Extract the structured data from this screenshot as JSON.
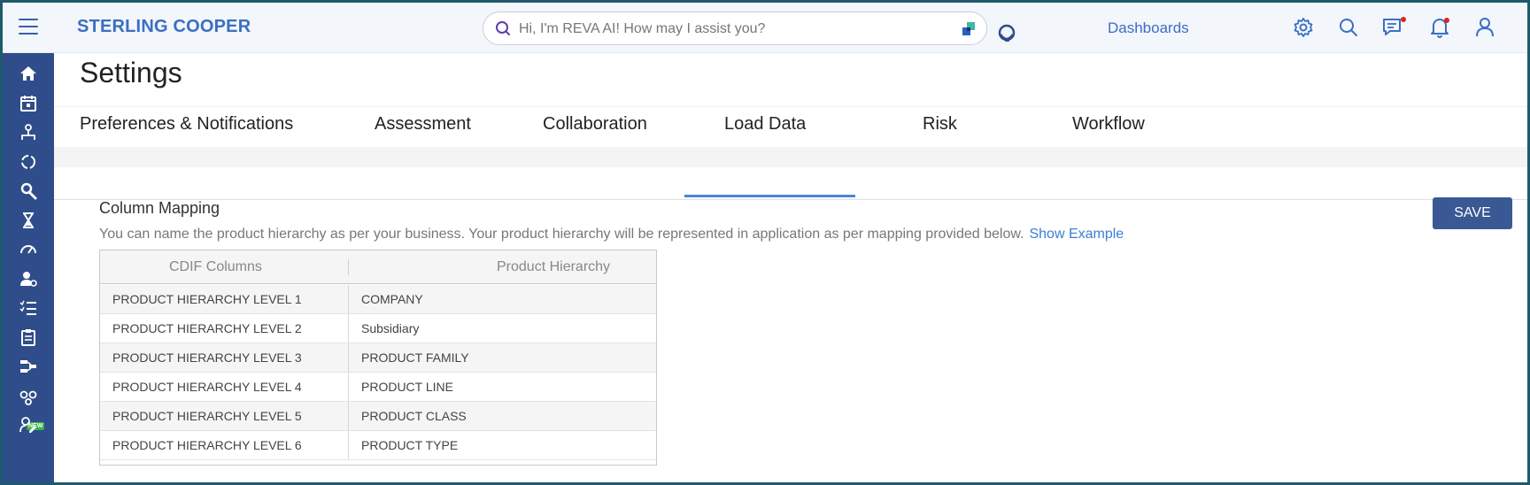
{
  "header": {
    "brand": "STERLING COOPER",
    "search_placeholder": "Hi, I'm REVA AI! How may I assist you?",
    "dashboards_label": "Dashboards",
    "icons": [
      "menu-icon",
      "search-icon",
      "agent-icon",
      "settings-icon",
      "search-icon",
      "messages-icon",
      "notifications-icon",
      "user-icon"
    ],
    "accent_color": "#3a6fc4",
    "alert_color": "#e02020"
  },
  "sidebar": {
    "items": [
      {
        "icon": "home-icon"
      },
      {
        "icon": "calendar-icon"
      },
      {
        "icon": "hierarchy-icon"
      },
      {
        "icon": "cycle-icon"
      },
      {
        "icon": "search-person-icon"
      },
      {
        "icon": "hourglass-icon"
      },
      {
        "icon": "gauge-icon"
      },
      {
        "icon": "user-settings-icon"
      },
      {
        "icon": "checklist-icon"
      },
      {
        "icon": "clipboard-icon"
      },
      {
        "icon": "workflow-icon"
      },
      {
        "icon": "new-feature-icon",
        "badge": "NEW"
      },
      {
        "icon": "user-edit-icon"
      }
    ],
    "background": "#2f4d8a"
  },
  "page": {
    "title": "Settings",
    "tabs": [
      {
        "label": "Preferences & Notifications",
        "active": false
      },
      {
        "label": "Assessment",
        "active": false
      },
      {
        "label": "Collaboration",
        "active": false
      },
      {
        "label": "Load Data",
        "active": true
      },
      {
        "label": "Risk",
        "active": false
      },
      {
        "label": "Workflow",
        "active": false
      }
    ]
  },
  "column_mapping": {
    "title": "Column Mapping",
    "description": "You can name the product hierarchy as per your business. Your product hierarchy will be represented in application as per mapping provided below.",
    "show_example": "Show Example",
    "save_label": "SAVE",
    "columns": [
      "CDIF Columns",
      "Product Hierarchy"
    ],
    "rows": [
      {
        "cdif": "PRODUCT HIERARCHY LEVEL 1",
        "hierarchy": "COMPANY"
      },
      {
        "cdif": "PRODUCT HIERARCHY LEVEL 2",
        "hierarchy": "Subsidiary"
      },
      {
        "cdif": "PRODUCT HIERARCHY LEVEL 3",
        "hierarchy": "PRODUCT FAMILY"
      },
      {
        "cdif": "PRODUCT HIERARCHY LEVEL 4",
        "hierarchy": "PRODUCT LINE"
      },
      {
        "cdif": "PRODUCT HIERARCHY LEVEL 5",
        "hierarchy": "PRODUCT CLASS"
      },
      {
        "cdif": "PRODUCT HIERARCHY LEVEL 6",
        "hierarchy": "PRODUCT TYPE"
      }
    ]
  }
}
